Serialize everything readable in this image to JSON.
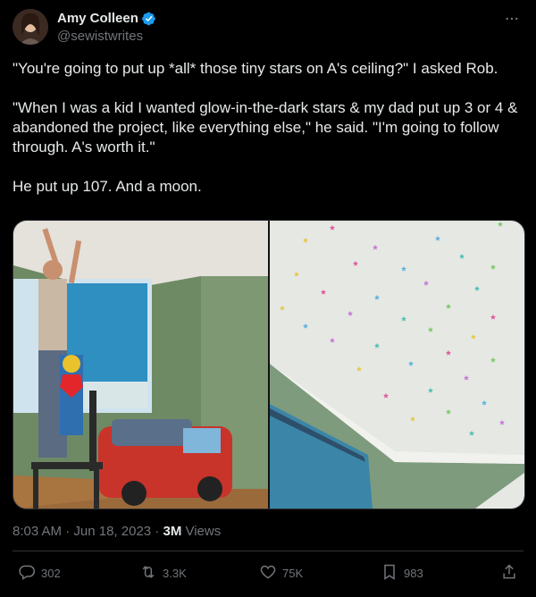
{
  "author": {
    "name": "Amy Colleen",
    "handle": "@sewistwrites"
  },
  "icons": {
    "verified": "verified-badge-icon",
    "more": "more-options-icon",
    "reply": "reply-icon",
    "retweet": "retweet-icon",
    "like": "like-icon",
    "bookmark": "bookmark-icon",
    "share": "share-icon"
  },
  "tweet": {
    "paragraphs": [
      "\"You're going to put up *all* those tiny stars on A's ceiling?\" I asked Rob.",
      "\"When I was a kid I wanted glow-in-the-dark stars & my dad put up 3 or 4 & abandoned the project, like everything else,\" he said. \"I'm going to follow through. A's worth it.\"",
      "He put up 107. And a moon."
    ]
  },
  "meta": {
    "time": "8:03 AM",
    "separator": " · ",
    "date": "Jun 18, 2023",
    "views_count": "3M",
    "views_label": " Views"
  },
  "stats": {
    "replies": "302",
    "retweets": "3.3K",
    "likes": "75K",
    "bookmarks": "983"
  },
  "colors": {
    "background": "#000000",
    "text": "#e7e9ea",
    "secondary": "#71767b",
    "verified": "#1d9bf0",
    "divider": "#2f3336"
  }
}
